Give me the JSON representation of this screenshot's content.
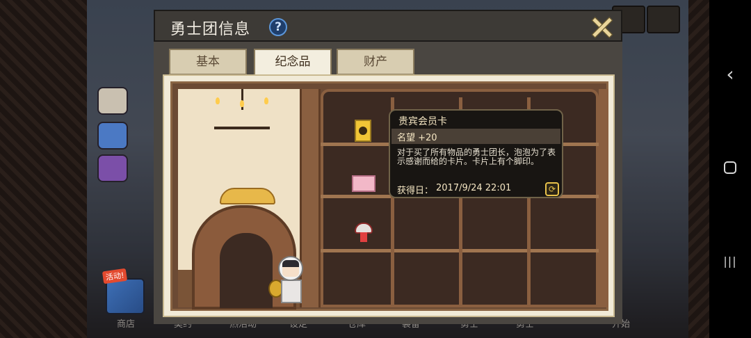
{
  "dialog": {
    "title": "勇士团信息",
    "help_glyph": "?",
    "tabs": [
      {
        "label": "基本",
        "active": false
      },
      {
        "label": "纪念品",
        "active": true
      },
      {
        "label": "财产",
        "active": false
      }
    ]
  },
  "tooltip": {
    "item_name": "贵宾会员卡",
    "fame": "名望 +20",
    "description": "对于买了所有物品的勇士团长，泡泡为了表示感谢而给的卡片。卡片上有个脚印。",
    "obtained_label": "获得日：",
    "obtained_date": "2017/9/24 22:01",
    "refresh_glyph": "⟳"
  },
  "background": {
    "event_badge": "活动!",
    "bottom_menu": [
      "商店",
      "契约",
      "热活动",
      "设定",
      "仓库",
      "装备",
      "勇士",
      "勇士",
      "开始"
    ]
  },
  "navbar": {
    "back_glyph": "‹",
    "recents_glyph": "|||"
  },
  "colors": {
    "panel_bg": "#f1ead7",
    "tooltip_bg": "#181512",
    "titlebar_bg": "#3d3a36",
    "accent_gold": "#e8c24a"
  }
}
